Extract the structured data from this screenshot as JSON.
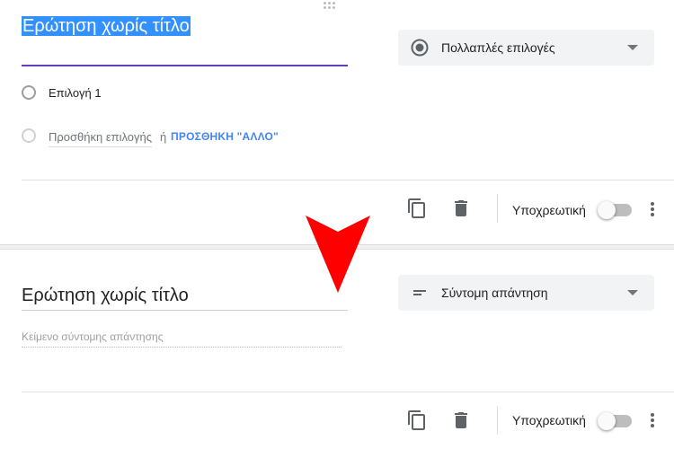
{
  "colors": {
    "accent": "#673ab7",
    "link": "#4285f4",
    "selection": "#3390ff",
    "annotation_arrow": "#ff0000"
  },
  "question1": {
    "title": "Ερώτηση χωρίς τίτλο",
    "type": {
      "label": "Πολλαπλές επιλογές",
      "icon": "radio-checked-icon"
    },
    "options": [
      {
        "label": "Επιλογή 1"
      }
    ],
    "add_option": "Προσθήκη επιλογής",
    "or_text": "ή",
    "add_other": "ΠΡΟΣΘΗΚΗ \"ΑΛΛΟ\"",
    "footer": {
      "required_label": "Υποχρεωτική",
      "required": false
    }
  },
  "question2": {
    "title": "Ερώτηση χωρίς τίτλο",
    "type": {
      "label": "Σύντομη απάντηση",
      "icon": "short-text-icon"
    },
    "answer_placeholder": "Κείμενο σύντομης απάντησης",
    "footer": {
      "required_label": "Υποχρεωτική",
      "required": false
    }
  }
}
